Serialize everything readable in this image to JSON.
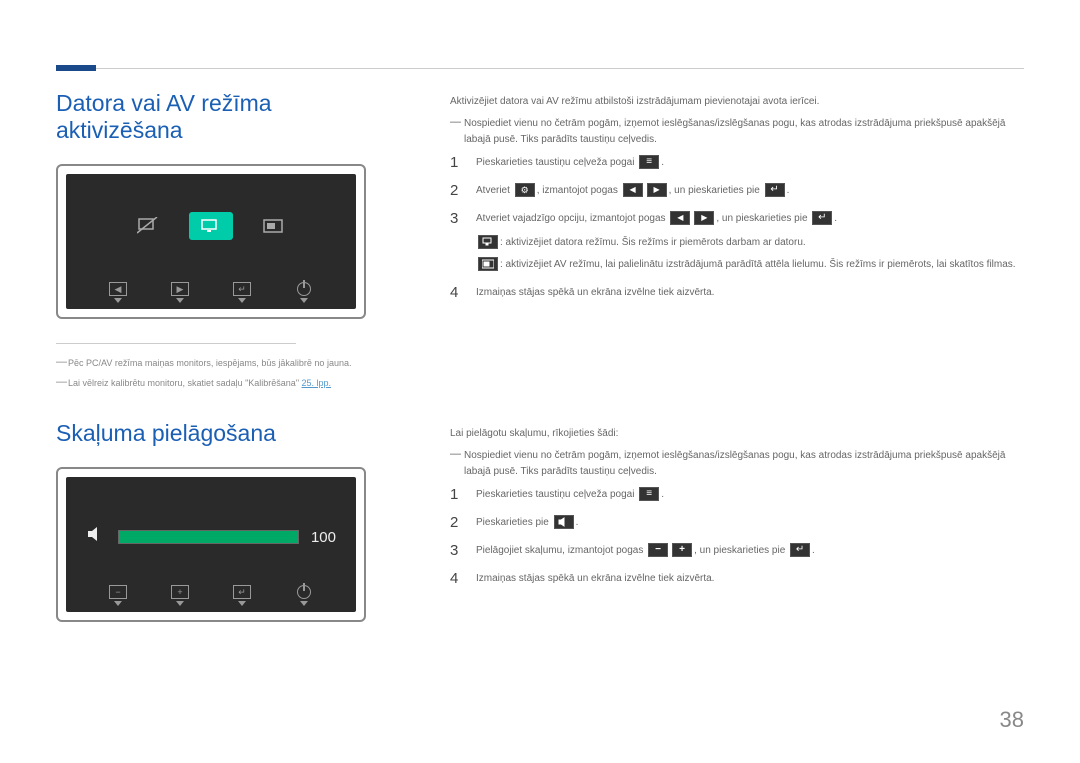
{
  "pageNumber": "38",
  "section1": {
    "title": "Datora vai AV režīma aktivizēšana",
    "footnote1": "Pēc PC/AV režīma maiņas monitors, iespējams, būs jākalibrē no jauna.",
    "footnote2_pre": "Lai vēlreiz kalibrētu monitoru, skatiet sadaļu \"Kalibrēšana\" ",
    "footnote2_link": "25. lpp.",
    "intro": "Aktivizējiet datora vai AV režīmu atbilstoši izstrādājumam pievienotajai avota ierīcei.",
    "note": "Nospiediet vienu no četrām pogām, izņemot ieslēgšanas/izslēgšanas pogu, kas atrodas izstrādājuma priekšpusē apakšējā labajā pusē. Tiks parādīts taustiņu ceļvedis.",
    "step1": "Pieskarieties taustiņu ceļveža pogai ",
    "step2_a": "Atveriet ",
    "step2_b": ", izmantojot pogas ",
    "step2_c": ", un pieskarieties pie ",
    "step3_a": "Atveriet vajadzīgo opciju, izmantojot pogas ",
    "step3_b": ", un pieskarieties pie ",
    "step3_sub1": ": aktivizējiet datora režīmu. Šis režīms ir piemērots darbam ar datoru.",
    "step3_sub2": ": aktivizējiet AV režīmu, lai palielinātu izstrādājumā parādītā attēla lielumu. Šis režīms ir piemērots, lai skatītos filmas.",
    "step4": "Izmaiņas stājas spēkā un ekrāna izvēlne tiek aizvērta."
  },
  "section2": {
    "title": "Skaļuma pielāgošana",
    "volume_value": "100",
    "intro": "Lai pielāgotu skaļumu, rīkojieties šādi:",
    "note": "Nospiediet vienu no četrām pogām, izņemot ieslēgšanas/izslēgšanas pogu, kas atrodas izstrādājuma priekšpusē apakšējā labajā pusē. Tiks parādīts taustiņu ceļvedis.",
    "step1": "Pieskarieties taustiņu ceļveža pogai ",
    "step2": "Pieskarieties pie ",
    "step3_a": "Pielāgojiet skaļumu, izmantojot pogas ",
    "step3_b": ", un pieskarieties pie ",
    "step4": "Izmaiņas stājas spēkā un ekrāna izvēlne tiek aizvērta."
  }
}
